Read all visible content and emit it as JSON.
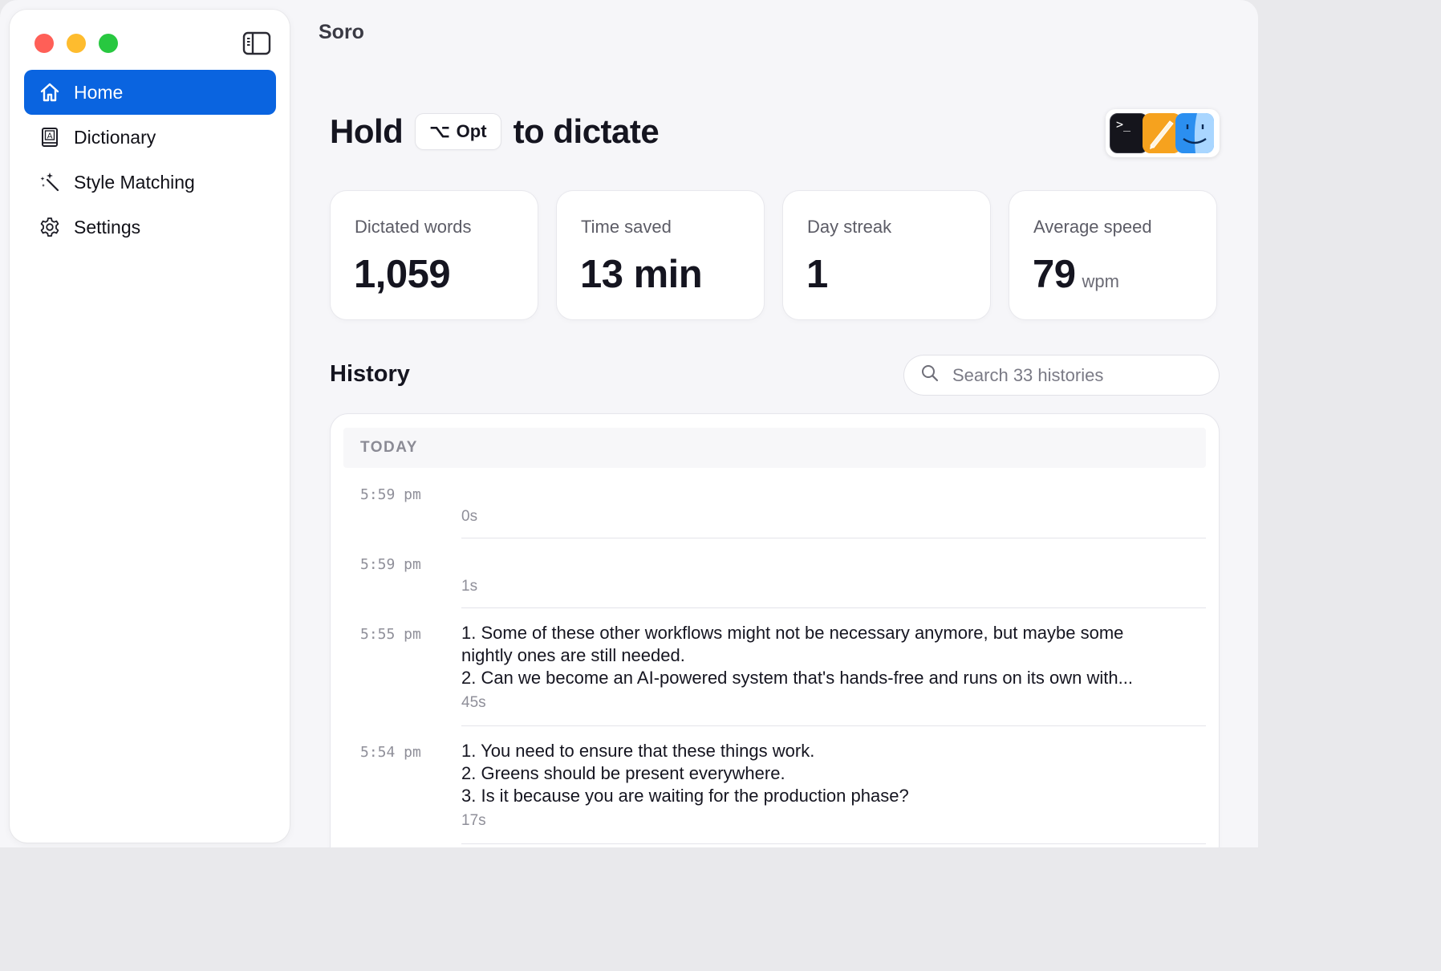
{
  "app": {
    "title": "Soro"
  },
  "sidebar": {
    "items": [
      {
        "label": "Home",
        "icon": "home-icon",
        "active": true
      },
      {
        "label": "Dictionary",
        "icon": "dictionary-icon",
        "active": false
      },
      {
        "label": "Style Matching",
        "icon": "magic-wand-icon",
        "active": false
      },
      {
        "label": "Settings",
        "icon": "gear-icon",
        "active": false
      }
    ]
  },
  "hero": {
    "prefix": "Hold",
    "key_symbol": "⌥",
    "key_label": "Opt",
    "suffix": "to dictate",
    "app_icons": [
      "terminal-app-icon",
      "pages-app-icon",
      "finder-app-icon"
    ]
  },
  "stats": [
    {
      "label": "Dictated words",
      "value": "1,059",
      "unit": ""
    },
    {
      "label": "Time saved",
      "value": "13 min",
      "unit": ""
    },
    {
      "label": "Day streak",
      "value": "1",
      "unit": ""
    },
    {
      "label": "Average speed",
      "value": "79",
      "unit": "wpm"
    }
  ],
  "history": {
    "title": "History",
    "search_placeholder": "Search 33 histories",
    "group_label": "TODAY",
    "entries": [
      {
        "time": "5:59 pm",
        "lines": [],
        "duration": "0s"
      },
      {
        "time": "5:59 pm",
        "lines": [],
        "duration": "1s"
      },
      {
        "time": "5:55 pm",
        "lines": [
          "1. Some of these other workflows might not be necessary anymore, but maybe some",
          "nightly ones are still needed.",
          "2. Can we become an AI-powered system that's hands-free and runs on its own with..."
        ],
        "duration": "45s"
      },
      {
        "time": "5:54 pm",
        "lines": [
          "1. You need to ensure that these things work.",
          "2. Greens should be present everywhere.",
          "3. Is it because you are waiting for the production phase?"
        ],
        "duration": "17s"
      }
    ]
  },
  "colors": {
    "accent": "#0a64e0",
    "traffic_red": "#ff5f57",
    "traffic_yellow": "#febc2e",
    "traffic_green": "#28c840"
  }
}
